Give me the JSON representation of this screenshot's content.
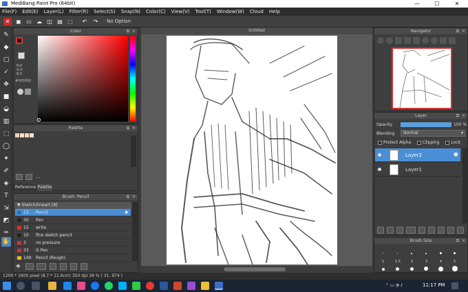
{
  "window": {
    "title": "MediBang Paint Pro (64bit)",
    "minimize": "—",
    "maximize": "☐",
    "close": "✕"
  },
  "menu": [
    "File(F)",
    "Edit(E)",
    "Layer(L)",
    "Filter(R)",
    "Select(S)",
    "Snap(N)",
    "Color(C)",
    "View(V)",
    "Tool(T)",
    "Window(W)",
    "Cloud",
    "Help"
  ],
  "toolbar": {
    "option_text": "No Option"
  },
  "color_panel": {
    "title": "Color",
    "rgb": [
      "R:0",
      "G:0",
      "B:0"
    ],
    "hex": "#000000",
    "fg": "#1a1a1a",
    "bg": "#ffffff",
    "accent": "#e0302a"
  },
  "palette_panel": {
    "title": "Palette",
    "swatches": [
      "#f3d2b8",
      "#f7e3cf",
      "#ffd9bd",
      "#fde4d0"
    ],
    "more": "...",
    "tabs": [
      "Reference",
      "Palette"
    ]
  },
  "brush_panel": {
    "title": "Brush: Pencil",
    "group": "Sketch/lineart [8]",
    "brushes": [
      {
        "num": "15",
        "name": "Pencil",
        "color": "#1e73c8",
        "selected": true
      },
      {
        "num": "30",
        "name": "Pen",
        "color": "#222222",
        "selected": false
      },
      {
        "num": "15",
        "name": "write",
        "color": "#d83030",
        "selected": false
      },
      {
        "num": "10",
        "name": "fine sketch pencil",
        "color": "#222222",
        "selected": false
      },
      {
        "num": "3",
        "name": "no pressure",
        "color": "#d83030",
        "selected": false
      },
      {
        "num": "33",
        "name": "G Pen",
        "color": "#d83030",
        "selected": false
      },
      {
        "num": "149",
        "name": "Pencil (Rough)",
        "color": "#e8c020",
        "selected": false
      }
    ]
  },
  "canvas": {
    "tab_title": "Untitled"
  },
  "navigator": {
    "title": "Navigator"
  },
  "layer_panel": {
    "title": "Layer",
    "opacity_label": "Opacity",
    "opacity_value": "100 %",
    "opacity_fraction": 1.0,
    "blending_label": "Blending",
    "blending_value": "Normal",
    "protect_alpha": "Protect Alpha",
    "clipping": "Clipping",
    "lock": "Lock",
    "layers": [
      {
        "name": "Layer2",
        "selected": true
      },
      {
        "name": "Layer1",
        "selected": false
      }
    ]
  },
  "brush_size_panel": {
    "title": "Brush Size",
    "sizes": [
      "1",
      "1.5",
      "2",
      "3",
      "4",
      "5"
    ]
  },
  "status": {
    "text": "1200 * 1600 pixel   (8.7 * 11.6cm)   350 dpi   39 %   ( 31, 974 )"
  },
  "taskbar": {
    "time": "11:17 PM"
  }
}
